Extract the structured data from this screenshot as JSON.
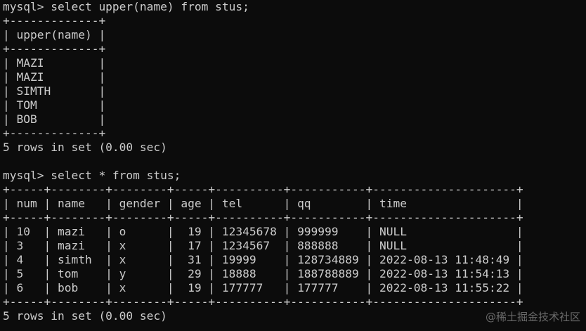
{
  "terminal": {
    "lines": [
      "mysql> select upper(name) from stus;",
      "+-------------+",
      "| upper(name) |",
      "+-------------+",
      "| MAZI        |",
      "| MAZI        |",
      "| SIMTH       |",
      "| TOM         |",
      "| BOB         |",
      "+-------------+",
      "5 rows in set (0.00 sec)",
      "",
      "mysql> select * from stus;",
      "+-----+--------+--------+-----+----------+-----------+---------------------+",
      "| num | name   | gender | age | tel      | qq        | time                |",
      "+-----+--------+--------+-----+----------+-----------+---------------------+",
      "| 10  | mazi   | o      |  19 | 12345678 | 999999    | NULL                |",
      "| 3   | mazi   | x      |  17 | 1234567  | 888888    | NULL                |",
      "| 4   | simth  | x      |  31 | 19999    | 128734889 | 2022-08-13 11:48:49 |",
      "| 5   | tom    | y      |  29 | 18888    | 188788889 | 2022-08-13 11:54:13 |",
      "| 6   | bob    | x      |  19 | 177777   | 177777    | 2022-08-13 11:55:22 |",
      "+-----+--------+--------+-----+----------+-----------+---------------------+",
      "5 rows in set (0.00 sec)"
    ]
  },
  "watermark": "@稀土掘金技术社区"
}
